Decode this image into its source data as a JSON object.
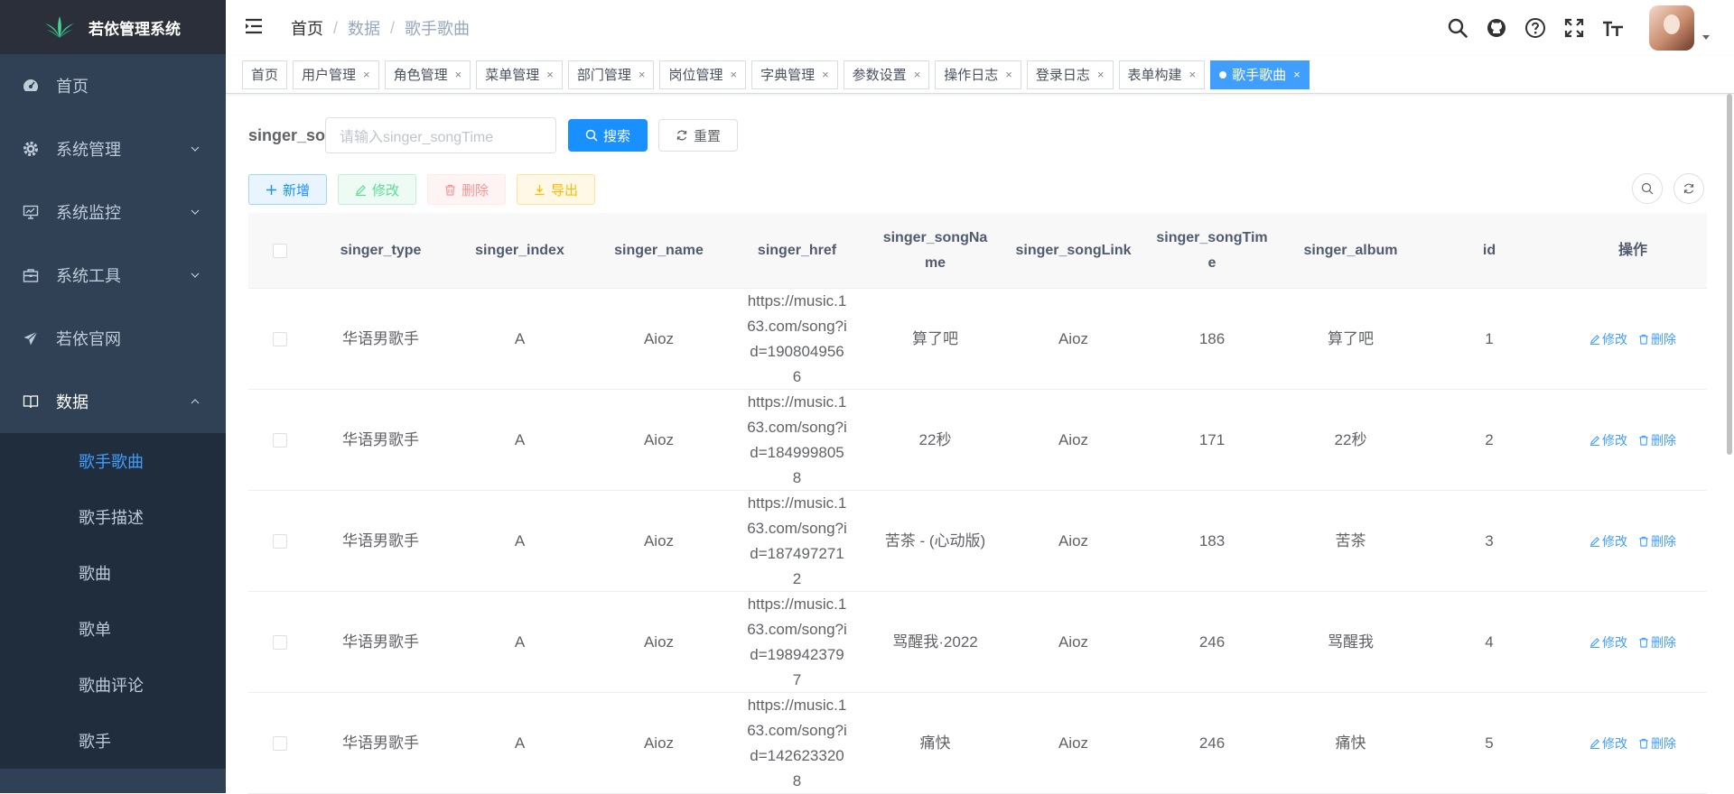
{
  "app": {
    "title": "若依管理系统"
  },
  "sidebar": {
    "menus": [
      {
        "label": "首页",
        "icon": "dashboard-icon"
      },
      {
        "label": "系统管理",
        "icon": "gear-icon"
      },
      {
        "label": "系统监控",
        "icon": "monitor-icon"
      },
      {
        "label": "系统工具",
        "icon": "toolbox-icon"
      },
      {
        "label": "若依官网",
        "icon": "send-icon"
      },
      {
        "label": "数据",
        "icon": "book-icon"
      }
    ],
    "submenu": [
      {
        "label": "歌手歌曲"
      },
      {
        "label": "歌手描述"
      },
      {
        "label": "歌曲"
      },
      {
        "label": "歌单"
      },
      {
        "label": "歌曲评论"
      },
      {
        "label": "歌手"
      }
    ]
  },
  "breadcrumb": {
    "home": "首页",
    "level1": "数据",
    "current": "歌手歌曲"
  },
  "tags": [
    {
      "label": "首页"
    },
    {
      "label": "用户管理"
    },
    {
      "label": "角色管理"
    },
    {
      "label": "菜单管理"
    },
    {
      "label": "部门管理"
    },
    {
      "label": "岗位管理"
    },
    {
      "label": "字典管理"
    },
    {
      "label": "参数设置"
    },
    {
      "label": "操作日志"
    },
    {
      "label": "登录日志"
    },
    {
      "label": "表单构建"
    },
    {
      "label": "歌手歌曲"
    }
  ],
  "search": {
    "label": "singer_songTime",
    "placeholder": "请输入singer_songTime",
    "search_btn": "搜索",
    "reset_btn": "重置"
  },
  "toolbar": {
    "add": "新增",
    "edit": "修改",
    "delete": "删除",
    "export": "导出"
  },
  "table": {
    "headers": [
      "singer_type",
      "singer_index",
      "singer_name",
      "singer_href",
      "singer_songName",
      "singer_songLink",
      "singer_songTime",
      "singer_album",
      "id",
      "操作"
    ],
    "rows": [
      {
        "type": "华语男歌手",
        "index": "A",
        "name": "Aioz",
        "href": "https://music.163.com/song?id=1908049566",
        "songName": "算了吧",
        "songLink": "Aioz",
        "songTime": "186",
        "album": "算了吧",
        "id": "1"
      },
      {
        "type": "华语男歌手",
        "index": "A",
        "name": "Aioz",
        "href": "https://music.163.com/song?id=1849998058",
        "songName": "22秒",
        "songLink": "Aioz",
        "songTime": "171",
        "album": "22秒",
        "id": "2"
      },
      {
        "type": "华语男歌手",
        "index": "A",
        "name": "Aioz",
        "href": "https://music.163.com/song?id=1874972712",
        "songName": "苦茶 - (心动版)",
        "songLink": "Aioz",
        "songTime": "183",
        "album": "苦茶",
        "id": "3"
      },
      {
        "type": "华语男歌手",
        "index": "A",
        "name": "Aioz",
        "href": "https://music.163.com/song?id=1989423797",
        "songName": "骂醒我·2022",
        "songLink": "Aioz",
        "songTime": "246",
        "album": "骂醒我",
        "id": "4"
      },
      {
        "type": "华语男歌手",
        "index": "A",
        "name": "Aioz",
        "href": "https://music.163.com/song?id=1426233208",
        "songName": "痛快",
        "songLink": "Aioz",
        "songTime": "246",
        "album": "痛快",
        "id": "5"
      }
    ],
    "op_edit": "修改",
    "op_delete": "删除"
  },
  "colors": {
    "sidebar_bg": "#304156",
    "submenu_bg": "#1f2d3d",
    "primary": "#1890ff",
    "active_tag": "#409eff"
  }
}
